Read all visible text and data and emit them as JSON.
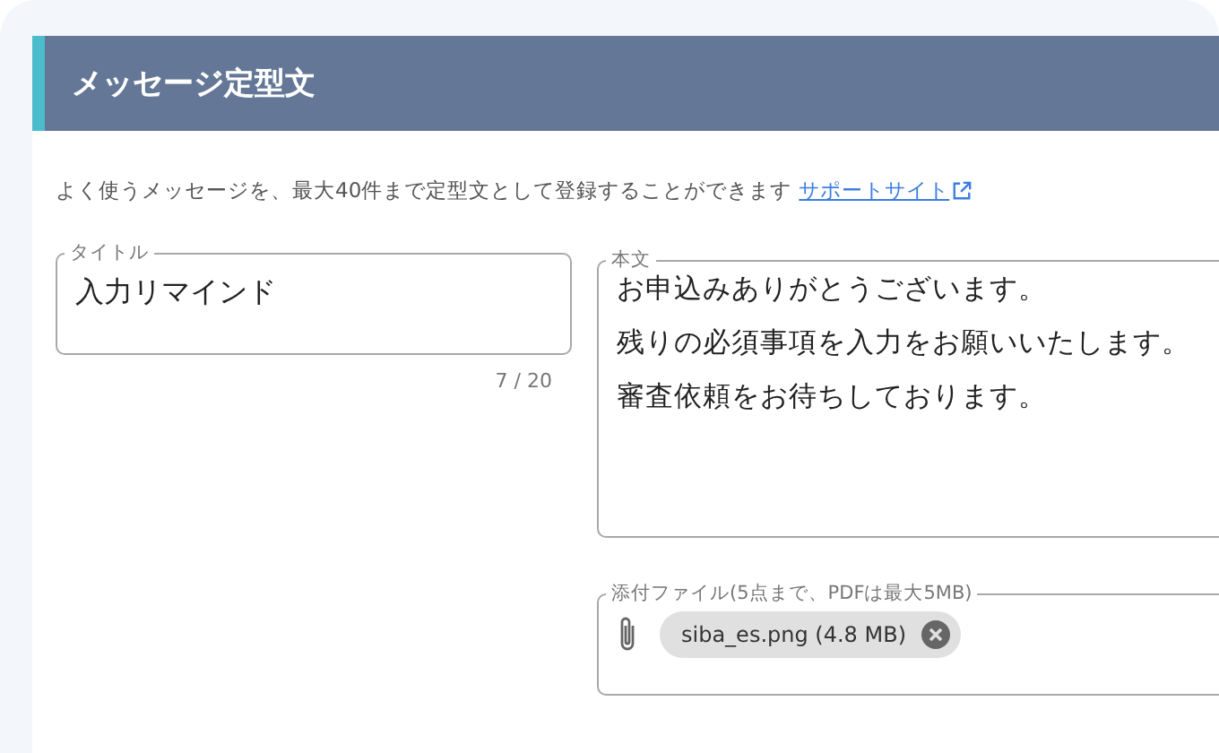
{
  "panel": {
    "title": "メッセージ定型文"
  },
  "description": {
    "text": "よく使うメッセージを、最大40件まで定型文として登録することができます",
    "link": "サポートサイト"
  },
  "title_field": {
    "label": "タイトル",
    "value": "入力リマインド",
    "counter": "7 / 20"
  },
  "body_field": {
    "label": "本文",
    "lines": [
      "お申込みありがとうございます。",
      "残りの必須事項を入力をお願いいたします。",
      "審査依頼をお待ちしております。"
    ]
  },
  "attachments": {
    "label": "添付ファイル(5点まで、PDFは最大5MB)",
    "files": [
      {
        "name": "siba_es.png (4.8 MB)"
      }
    ]
  }
}
